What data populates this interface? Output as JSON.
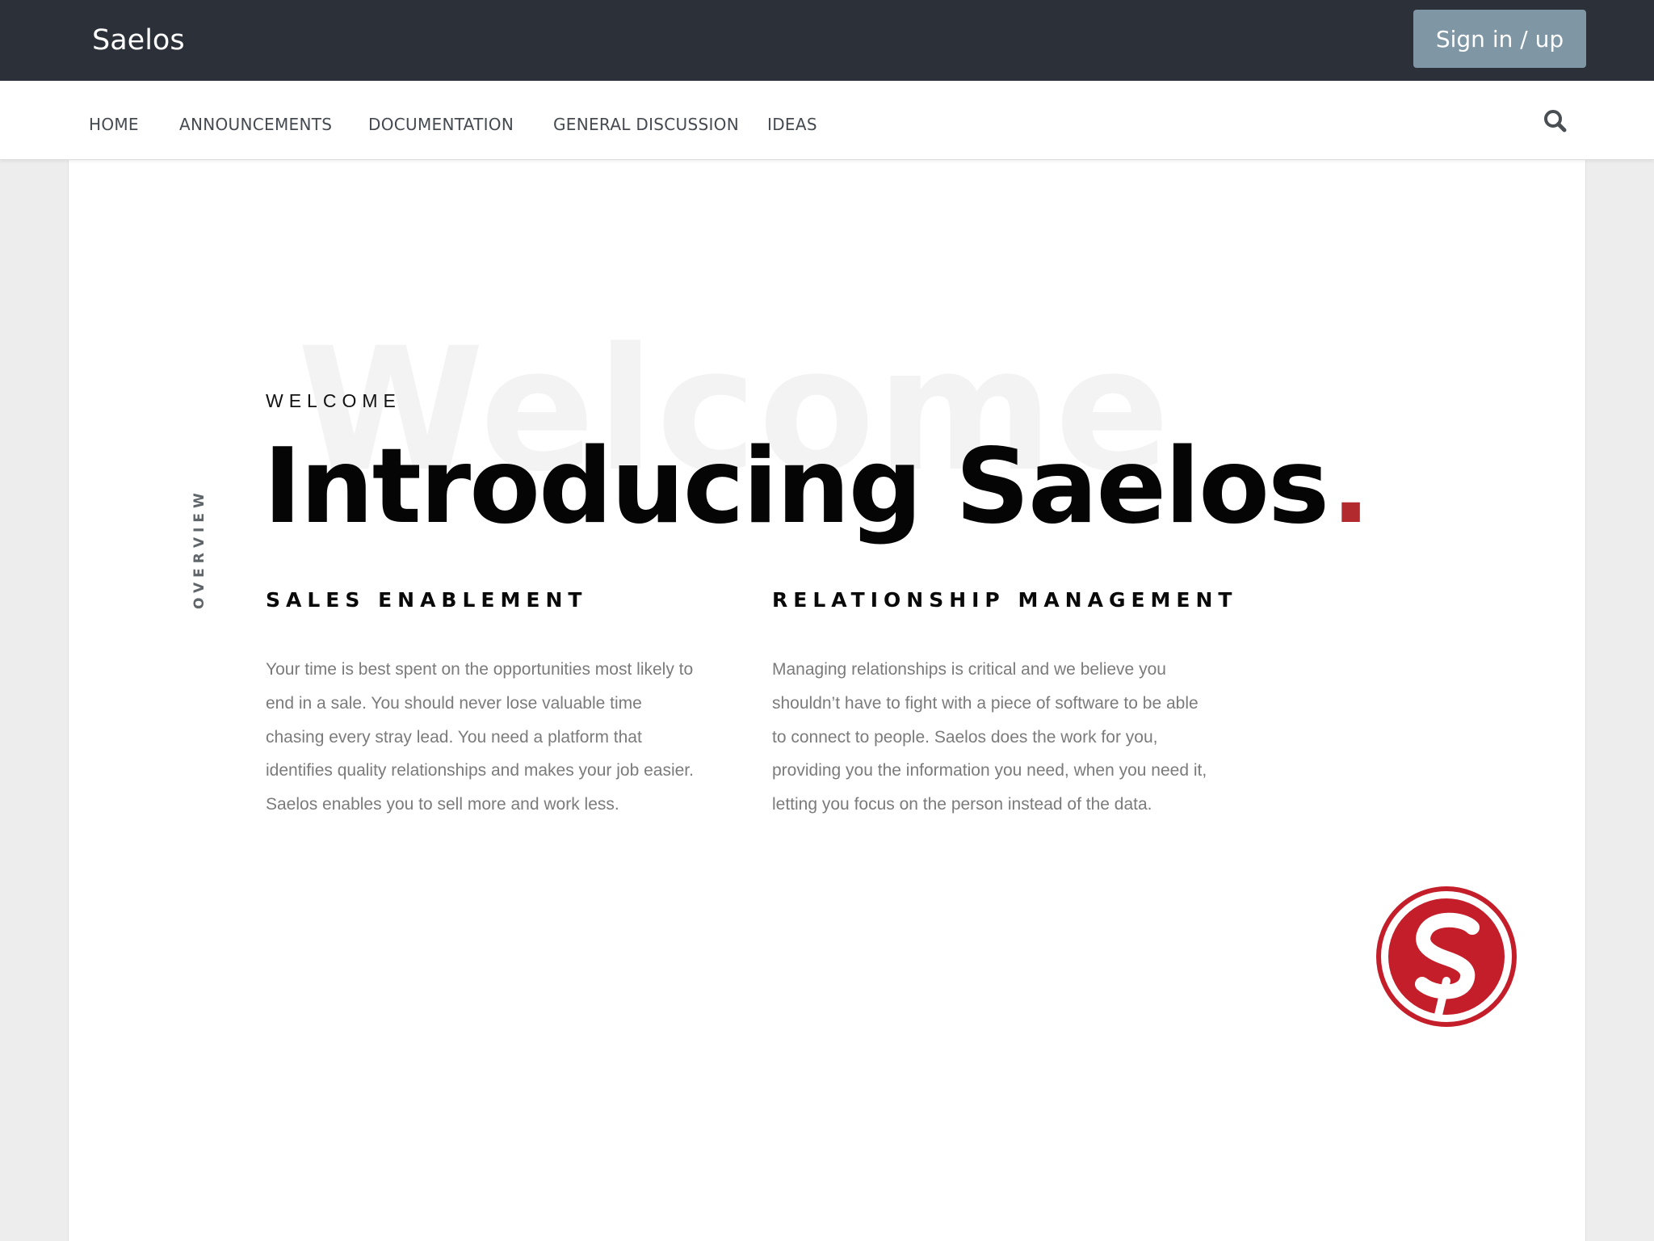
{
  "header": {
    "brand": "Saelos",
    "signin_label": "Sign in / up"
  },
  "nav": {
    "items": [
      {
        "label": "HOME"
      },
      {
        "label": "ANNOUNCEMENTS"
      },
      {
        "label": "DOCUMENTATION"
      },
      {
        "label": "GENERAL DISCUSSION"
      },
      {
        "label": "IDEAS"
      }
    ],
    "search_icon": "search-icon"
  },
  "hero": {
    "background_word": "Welcome",
    "eyebrow": "WELCOME",
    "headline": "Introducing Saelos",
    "headline_dot": ".",
    "side_label": "OVERVIEW",
    "accent_color": "#b22a2e"
  },
  "columns": [
    {
      "title": "SALES ENABLEMENT",
      "body": "Your time is best spent on the opportunities most likely to end in a sale. You should never lose valuable time chasing every stray lead. You need a platform that identifies quality relationships and makes your job easier. Saelos enables you to sell more and work less."
    },
    {
      "title": "RELATIONSHIP MANAGEMENT",
      "body": "Managing relationships is critical and we believe you shouldn’t have to fight with a piece of software to be able to connect to people. Saelos does the work for you, providing you the information you need, when you need it, letting you focus on the person instead of the data."
    }
  ],
  "logo": {
    "icon": "saelos-logo-icon",
    "color": "#c41e2a"
  },
  "colors": {
    "topbar": "#2c3139",
    "signin_button": "#7f96a5",
    "page_background": "#ededed"
  }
}
